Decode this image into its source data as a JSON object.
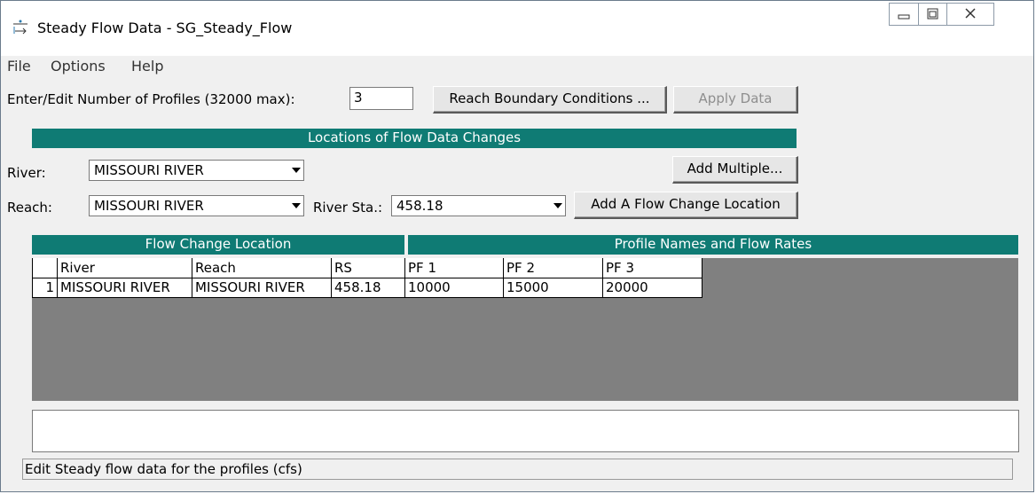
{
  "window": {
    "title": "Steady Flow Data - SG_Steady_Flow",
    "icon": "flow-app-icon",
    "controls": [
      "minimize-icon",
      "restore-icon",
      "close-icon"
    ]
  },
  "menu": {
    "items": [
      "File",
      "Options",
      "Help"
    ]
  },
  "profiles": {
    "label": "Enter/Edit Number of Profiles (32000 max):",
    "value": "3",
    "reach_boundary_button": "Reach Boundary Conditions ...",
    "apply_button": "Apply Data"
  },
  "locations": {
    "header": "Locations of Flow Data Changes",
    "river_label": "River:",
    "river_value": "MISSOURI RIVER",
    "add_multiple_button": "Add Multiple...",
    "reach_label": "Reach:",
    "reach_value": "MISSOURI RIVER",
    "river_sta_label": "River Sta.:",
    "river_sta_value": "458.18",
    "add_location_button": "Add A Flow Change Location"
  },
  "table": {
    "left_header": "Flow Change Location",
    "right_header": "Profile Names and Flow Rates",
    "columns": [
      "River",
      "Reach",
      "RS",
      "PF 1",
      "PF 2",
      "PF 3"
    ],
    "rows": [
      {
        "index": "1",
        "cells": [
          "MISSOURI RIVER",
          "MISSOURI RIVER",
          "458.18",
          "10000",
          "15000",
          "20000"
        ]
      }
    ]
  },
  "status": "Edit Steady flow data for the profiles (cfs)",
  "colors": {
    "header_teal": "#0f7b74",
    "grid_gray": "#808080"
  }
}
